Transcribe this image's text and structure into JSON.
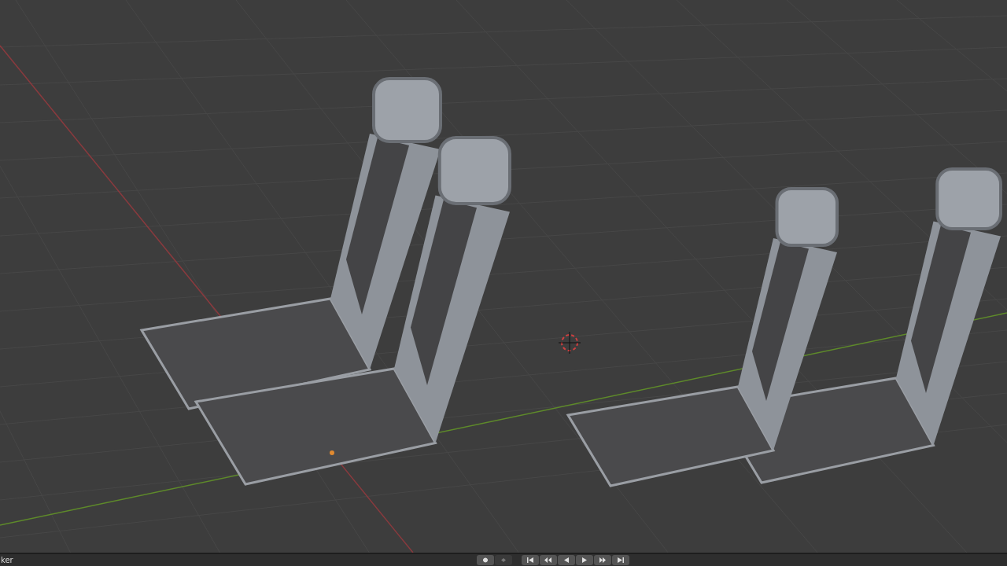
{
  "timeline": {
    "label": "ker",
    "keying_on": false
  }
}
